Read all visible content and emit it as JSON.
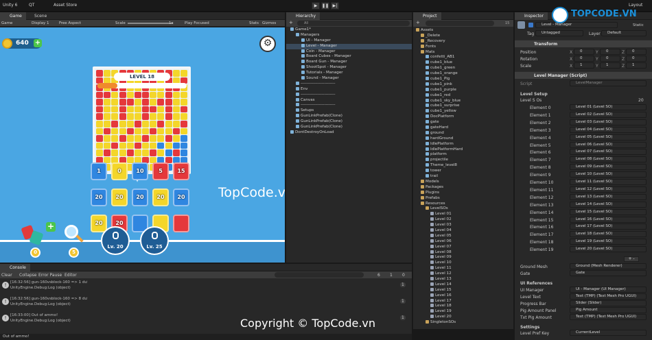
{
  "topbar": {
    "app_title": "Unity 6",
    "qt_label": "QT",
    "asset_store": "Asset Store",
    "layout": "Layout"
  },
  "game_panel": {
    "tabs": [
      "Game",
      "Scene"
    ],
    "toolbar": {
      "view": "Game",
      "display": "Display 1",
      "aspect": "Free Aspect",
      "scale_label": "Scale",
      "scale_value": "1x",
      "play_mode": "Play Focused",
      "stats": "Stats",
      "gizmos": "Gizmos"
    },
    "coins": "640",
    "level_title": "LEVEL 18",
    "gun_values": [
      [
        "1",
        "0",
        "10",
        "5",
        "15"
      ],
      [
        "20",
        "20",
        "20",
        "20",
        "20"
      ],
      [
        "20",
        "20",
        "",
        "",
        ""
      ]
    ],
    "booster_counts": [
      "0",
      "5"
    ],
    "locked_levels": [
      "Lv. 20",
      "Lv. 25"
    ],
    "watermark": "TopCode.vn"
  },
  "hierarchy": {
    "title": "Hierarchy",
    "search": "All",
    "items": [
      {
        "label": "Game1*",
        "depth": 0
      },
      {
        "label": "Managers",
        "depth": 1
      },
      {
        "label": "UI - Manager",
        "depth": 2
      },
      {
        "label": "Level - Manager",
        "depth": 2,
        "selected": true
      },
      {
        "label": "Coin - Manager",
        "depth": 2
      },
      {
        "label": "Board Cubes - Manager",
        "depth": 2
      },
      {
        "label": "Board Gun - Manager",
        "depth": 2
      },
      {
        "label": "ShootSpot - Manager",
        "depth": 2
      },
      {
        "label": "Tutorials - Manager",
        "depth": 2
      },
      {
        "label": "Sound - Manager",
        "depth": 2
      },
      {
        "label": "-------------------------",
        "depth": 1
      },
      {
        "label": "Env",
        "depth": 1
      },
      {
        "label": "-------------------------",
        "depth": 1
      },
      {
        "label": "Canvas",
        "depth": 1
      },
      {
        "label": "-------------------------",
        "depth": 1
      },
      {
        "label": "Setups",
        "depth": 1
      },
      {
        "label": "GunLinkPrefab(Clone)",
        "depth": 1
      },
      {
        "label": "GunLinkPrefab(Clone)",
        "depth": 1
      },
      {
        "label": "GunLinkPrefab(Clone)",
        "depth": 1
      },
      {
        "label": "DontDestroyOnLoad",
        "depth": 0
      }
    ]
  },
  "project": {
    "title": "Project",
    "count": "15",
    "items": [
      {
        "label": "Assets",
        "depth": 0,
        "type": "folder"
      },
      {
        "label": "_Delete",
        "depth": 1,
        "type": "folder"
      },
      {
        "label": "_Recovery",
        "depth": 1,
        "type": "folder"
      },
      {
        "label": "Fonts",
        "depth": 1,
        "type": "folder"
      },
      {
        "label": "Mats",
        "depth": 1,
        "type": "folder"
      },
      {
        "label": "confetti_AB1",
        "depth": 2,
        "type": "asset"
      },
      {
        "label": "cube1_blue",
        "depth": 2,
        "type": "asset"
      },
      {
        "label": "cube1_green",
        "depth": 2,
        "type": "asset"
      },
      {
        "label": "cube1_orange",
        "depth": 2,
        "type": "asset"
      },
      {
        "label": "cube1_Pig",
        "depth": 2,
        "type": "asset"
      },
      {
        "label": "cube1_pink",
        "depth": 2,
        "type": "asset"
      },
      {
        "label": "cube1_purple",
        "depth": 2,
        "type": "asset"
      },
      {
        "label": "cube1_red",
        "depth": 2,
        "type": "asset"
      },
      {
        "label": "cube1_sky_blue",
        "depth": 2,
        "type": "asset"
      },
      {
        "label": "cube1_surprise",
        "depth": 2,
        "type": "asset"
      },
      {
        "label": "cube1_yellow",
        "depth": 2,
        "type": "asset"
      },
      {
        "label": "DocPlatform",
        "depth": 2,
        "type": "asset"
      },
      {
        "label": "gate",
        "depth": 2,
        "type": "asset"
      },
      {
        "label": "gateHard",
        "depth": 2,
        "type": "asset"
      },
      {
        "label": "ground",
        "depth": 2,
        "type": "asset"
      },
      {
        "label": "hardGround",
        "depth": 2,
        "type": "asset"
      },
      {
        "label": "IdlePlatform",
        "depth": 2,
        "type": "asset"
      },
      {
        "label": "IdlePlatformHard",
        "depth": 2,
        "type": "asset"
      },
      {
        "label": "platform",
        "depth": 2,
        "type": "asset"
      },
      {
        "label": "projectile",
        "depth": 2,
        "type": "asset"
      },
      {
        "label": "Theme_level8",
        "depth": 2,
        "type": "asset"
      },
      {
        "label": "tower",
        "depth": 2,
        "type": "asset"
      },
      {
        "label": "trail",
        "depth": 2,
        "type": "asset"
      },
      {
        "label": "Models",
        "depth": 1,
        "type": "folder"
      },
      {
        "label": "Packages",
        "depth": 1,
        "type": "folder"
      },
      {
        "label": "Plugins",
        "depth": 1,
        "type": "folder"
      },
      {
        "label": "Prefabs",
        "depth": 1,
        "type": "folder"
      },
      {
        "label": "Resources",
        "depth": 1,
        "type": "folder"
      },
      {
        "label": "LevelSOs",
        "depth": 2,
        "type": "folder"
      },
      {
        "label": "Level 01",
        "depth": 3,
        "type": "file"
      },
      {
        "label": "Level 02",
        "depth": 3,
        "type": "file"
      },
      {
        "label": "Level 03",
        "depth": 3,
        "type": "file"
      },
      {
        "label": "Level 04",
        "depth": 3,
        "type": "file"
      },
      {
        "label": "Level 05",
        "depth": 3,
        "type": "file"
      },
      {
        "label": "Level 06",
        "depth": 3,
        "type": "file"
      },
      {
        "label": "Level 07",
        "depth": 3,
        "type": "file"
      },
      {
        "label": "Level 08",
        "depth": 3,
        "type": "file"
      },
      {
        "label": "Level 09",
        "depth": 3,
        "type": "file"
      },
      {
        "label": "Level 10",
        "depth": 3,
        "type": "file"
      },
      {
        "label": "Level 11",
        "depth": 3,
        "type": "file"
      },
      {
        "label": "Level 12",
        "depth": 3,
        "type": "file"
      },
      {
        "label": "Level 13",
        "depth": 3,
        "type": "file"
      },
      {
        "label": "Level 14",
        "depth": 3,
        "type": "file"
      },
      {
        "label": "Level 15",
        "depth": 3,
        "type": "file"
      },
      {
        "label": "Level 16",
        "depth": 3,
        "type": "file"
      },
      {
        "label": "Level 17",
        "depth": 3,
        "type": "file"
      },
      {
        "label": "Level 18",
        "depth": 3,
        "type": "file"
      },
      {
        "label": "Level 19",
        "depth": 3,
        "type": "file"
      },
      {
        "label": "Level 20",
        "depth": 3,
        "type": "file"
      },
      {
        "label": "SingletonSOs",
        "depth": 2,
        "type": "folder"
      }
    ]
  },
  "inspector": {
    "title": "Inspector",
    "object_name": "Level - Manager",
    "static": "Static",
    "tag_label": "Tag",
    "tag_value": "Untagged",
    "layer_label": "Layer",
    "layer_value": "Default",
    "transform": {
      "title": "Transform",
      "position": "Position",
      "rotation": "Rotation",
      "scale": "Scale",
      "pos": [
        "0",
        "0",
        "0"
      ],
      "rot": [
        "0",
        "0",
        "0"
      ],
      "scl": [
        "1",
        "1",
        "1"
      ]
    },
    "script_title": "Level Manager (Script)",
    "script_label": "Script",
    "script_value": "LevelManager",
    "level_setup": "Level Setup",
    "level_sos_label": "Level S Os",
    "level_sos_count": "20",
    "elements": [
      {
        "name": "Element 0",
        "value": "Level 01 (Level SO)"
      },
      {
        "name": "Element 1",
        "value": "Level 02 (Level SO)"
      },
      {
        "name": "Element 2",
        "value": "Level 03 (Level SO)"
      },
      {
        "name": "Element 3",
        "value": "Level 04 (Level SO)"
      },
      {
        "name": "Element 4",
        "value": "Level 05 (Level SO)"
      },
      {
        "name": "Element 5",
        "value": "Level 06 (Level SO)"
      },
      {
        "name": "Element 6",
        "value": "Level 07 (Level SO)"
      },
      {
        "name": "Element 7",
        "value": "Level 08 (Level SO)"
      },
      {
        "name": "Element 8",
        "value": "Level 09 (Level SO)"
      },
      {
        "name": "Element 9",
        "value": "Level 10 (Level SO)"
      },
      {
        "name": "Element 10",
        "value": "Level 11 (Level SO)"
      },
      {
        "name": "Element 11",
        "value": "Level 12 (Level SO)"
      },
      {
        "name": "Element 12",
        "value": "Level 13 (Level SO)"
      },
      {
        "name": "Element 13",
        "value": "Level 14 (Level SO)"
      },
      {
        "name": "Element 14",
        "value": "Level 15 (Level SO)"
      },
      {
        "name": "Element 15",
        "value": "Level 16 (Level SO)"
      },
      {
        "name": "Element 16",
        "value": "Level 17 (Level SO)"
      },
      {
        "name": "Element 17",
        "value": "Level 18 (Level SO)"
      },
      {
        "name": "Element 18",
        "value": "Level 19 (Level SO)"
      },
      {
        "name": "Element 19",
        "value": "Level 20 (Level SO)"
      }
    ],
    "ground_mesh_label": "Ground Mesh",
    "ground_mesh_value": "Ground (Mesh Renderer)",
    "gate_label": "Gate",
    "gate_value": "Gate",
    "ui_refs": "UI References",
    "refs": [
      {
        "name": "UI Manager",
        "value": "UI - Manager (UI Manager)"
      },
      {
        "name": "Level Text",
        "value": "Text (TMP) (Text Mesh Pro UGUI)"
      },
      {
        "name": "Progress Bar",
        "value": "Slider (Slider)"
      },
      {
        "name": "Pig Amount Panel",
        "value": "Pig Amount"
      },
      {
        "name": "Txt Pig Amount",
        "value": "Text (TMP) (Text Mesh Pro UGUI)"
      }
    ],
    "settings": "Settings",
    "pref_key_label": "Level Pref Key",
    "pref_key_value": "CurrentLevel"
  },
  "console": {
    "title": "Console",
    "buttons": [
      "Clear",
      "Collapse",
      "Error Pause",
      "Editor"
    ],
    "counts": [
      "6",
      "1",
      "0"
    ],
    "logs": [
      {
        "line1": "[16:32:56] gun-160vsblock-160 => 1 dư",
        "line2": "UnityEngine.Debug:Log (object)",
        "count": "1"
      },
      {
        "line1": "[16:32:56] gun-160vsblock-160 => 8 dư",
        "line2": "UnityEngine.Debug:Log (object)",
        "count": "1"
      },
      {
        "line1": "[16:33:00] Out of ammo!",
        "line2": "UnityEngine.Debug:Log (object)",
        "count": "1"
      }
    ],
    "status": "Out of ammo!"
  },
  "watermarks": {
    "logo": "TOPCODE.VN",
    "copyright": "Copyright © TopCode.vn"
  }
}
